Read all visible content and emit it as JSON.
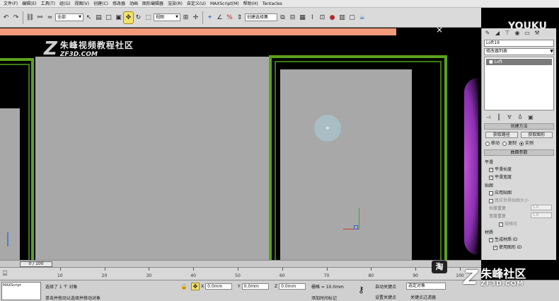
{
  "menu": [
    "文件(F)",
    "编辑(E)",
    "工具(T)",
    "组(G)",
    "视图(V)",
    "创建(C)",
    "修改器",
    "动画",
    "图形编辑器",
    "渲染(R)",
    "自定义(U)",
    "MAXScript(M)",
    "帮助(H)",
    "Tentacles"
  ],
  "toolbar": {
    "selection_filter": "全部",
    "reference_coord": "视图",
    "named_selection": "创建选择集"
  },
  "overlay": {
    "logo_cn": "朱峰视频教程社区",
    "logo_url": "ZF3D.COM",
    "close": "×",
    "youku_en": "YOUKU",
    "youku_cn": "优酷",
    "taobao": "淘",
    "bottom_cn": "朱峰社区",
    "bottom_url": "ZF3D.COM"
  },
  "command_panel": {
    "object_name": "Loft19",
    "modifier_list": "修改器列表",
    "stack_item": "Loft",
    "creation_method_title": "创建方法",
    "get_path": "获取路径",
    "get_shape": "获取图形",
    "radio_move": "移动",
    "radio_copy": "复制",
    "radio_instance": "实例",
    "surface_params_title": "曲面参数",
    "smoothing_label": "平滑",
    "smooth_length": "平滑长度",
    "smooth_width": "平滑宽度",
    "mapping_label": "贴图",
    "apply_mapping": "应用贴图",
    "real_world_map": "真实世界贴图大小",
    "length_repeat": "长度重复",
    "width_repeat": "宽度重复",
    "repeat_value": "1.0",
    "normalize": "规格化",
    "materials_label": "材质",
    "gen_material_ids": "生成材质 ID",
    "use_shape_ids": "使用图形 ID"
  },
  "timeline": {
    "position": "0 / 100",
    "ticks": [
      "10",
      "20",
      "30",
      "40",
      "50",
      "60",
      "70",
      "80",
      "90",
      "100"
    ]
  },
  "status": {
    "script": "MAXScript",
    "selected": "选择了 1 个 对象",
    "prompt": "单击并拖动以选择并移动对象",
    "x_label": "X",
    "x_val": "0.0mm",
    "y_label": "Y",
    "y_val": "0.0mm",
    "z_label": "Z",
    "z_val": "0.0mm",
    "grid": "栅格 = 10.0mm",
    "add_time_tag": "添加时间标记",
    "auto_key": "自动关键点",
    "selected_obj": "选定对象",
    "set_key": "设置关键点",
    "key_filters": "关键点过滤器"
  }
}
